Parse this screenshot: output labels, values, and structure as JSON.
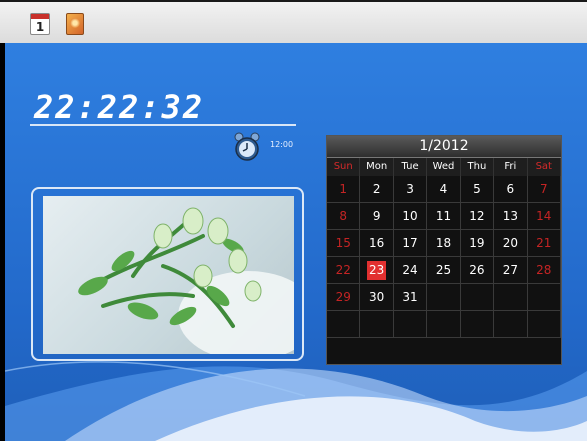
{
  "toolbar": {
    "calendar_icon_number": "1",
    "icons": [
      "calendar-icon",
      "photo-icon"
    ]
  },
  "clock": {
    "time": "22:22:32",
    "alarm_time": "12:00"
  },
  "calendar": {
    "title": "1/2012",
    "weekdays": [
      "Sun",
      "Mon",
      "Tue",
      "Wed",
      "Thu",
      "Fri",
      "Sat"
    ],
    "weeks": [
      [
        "1",
        "2",
        "3",
        "4",
        "5",
        "6",
        "7"
      ],
      [
        "8",
        "9",
        "10",
        "11",
        "12",
        "13",
        "14"
      ],
      [
        "15",
        "16",
        "17",
        "18",
        "19",
        "20",
        "21"
      ],
      [
        "22",
        "23",
        "24",
        "25",
        "26",
        "27",
        "28"
      ],
      [
        "29",
        "30",
        "31",
        "",
        "",
        "",
        ""
      ],
      [
        "",
        "",
        "",
        "",
        "",
        "",
        ""
      ]
    ],
    "today": "23",
    "weekend_color": "#d42a2a",
    "today_color": "#e23030"
  },
  "colors": {
    "background": "#2a74d8",
    "topbar": "#e6e6e6"
  }
}
